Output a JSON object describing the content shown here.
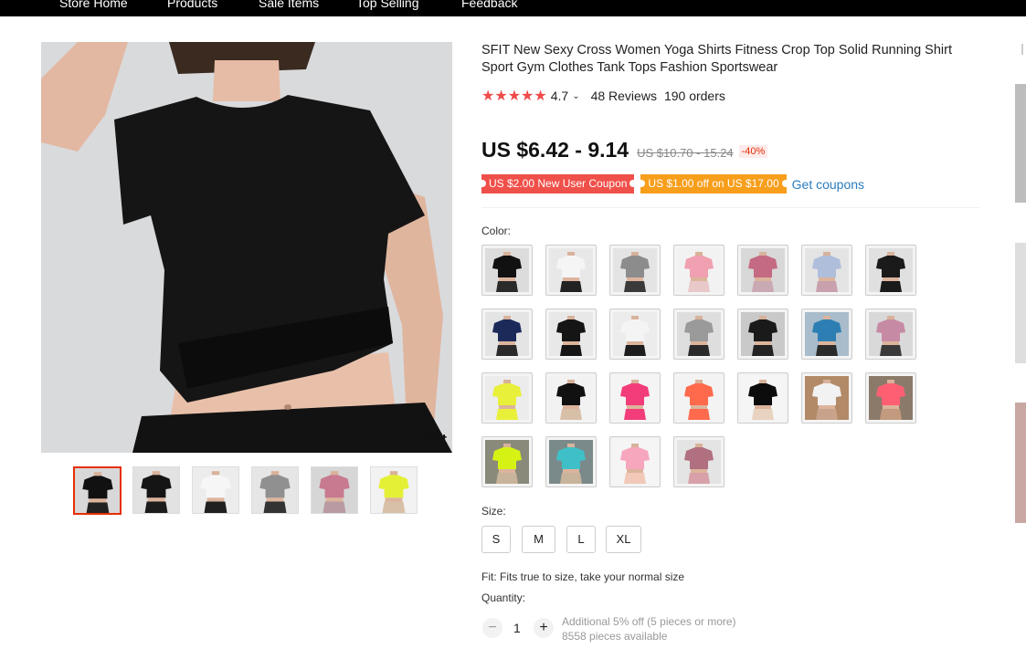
{
  "nav": {
    "items": [
      "Store Home",
      "Products",
      "Sale Items",
      "Top Selling",
      "Feedback"
    ]
  },
  "product": {
    "title": "SFIT New Sexy Cross Women Yoga Shirts Fitness Crop Top Solid Running Shirt Sport Gym Clothes Tank Tops Fashion Sportswear",
    "brand_mark": "Sfit",
    "rating": "4.7",
    "rating_stars": 5,
    "reviews": "48 Reviews",
    "orders": "190 orders",
    "price": "US $6.42 - 9.14",
    "old_price": "US $10.70 - 15.24",
    "discount": "-40%"
  },
  "coupons": {
    "new_user": "US $2.00 New User Coupon",
    "off": "US $1.00 off on US $17.00",
    "get_label": "Get coupons"
  },
  "color": {
    "label": "Color:",
    "swatches": [
      {
        "top": "#111111",
        "bottom": "#2a2a2a",
        "bg": "#dcdcdc"
      },
      {
        "top": "#f5f5f5",
        "bottom": "#222222",
        "bg": "#e8e8e8"
      },
      {
        "top": "#8c8c8c",
        "bottom": "#3a3a3a",
        "bg": "#e4e4e4"
      },
      {
        "top": "#f0a0b0",
        "bottom": "#e8c8c8",
        "bg": "#f2f2f2"
      },
      {
        "top": "#c46a82",
        "bottom": "#c9a9b2",
        "bg": "#d8d8d8"
      },
      {
        "top": "#aebedb",
        "bottom": "#c8a1ad",
        "bg": "#e4e4e4"
      },
      {
        "top": "#1a1a1a",
        "bottom": "#1a1a1a",
        "bg": "#e0e0e0"
      },
      {
        "top": "#1c2a5a",
        "bottom": "#2a2a2a",
        "bg": "#e4e4e4"
      },
      {
        "top": "#151515",
        "bottom": "#151515",
        "bg": "#e8e8e8"
      },
      {
        "top": "#f4f4f4",
        "bottom": "#1d1d1d",
        "bg": "#ececec"
      },
      {
        "top": "#9a9a9a",
        "bottom": "#2a2a2a",
        "bg": "#dedede"
      },
      {
        "top": "#1a1a1a",
        "bottom": "#222222",
        "bg": "#c9c9c9"
      },
      {
        "top": "#2d7fb3",
        "bottom": "#2a2a2a",
        "bg": "#a8bccb"
      },
      {
        "top": "#c78aa4",
        "bottom": "#3a3a3a",
        "bg": "#d9d9d9"
      },
      {
        "top": "#e8f03a",
        "bottom": "#e8f03a",
        "bg": "#ececec"
      },
      {
        "top": "#111111",
        "bottom": "#d8bfa8",
        "bg": "#f2f2f2"
      },
      {
        "top": "#f23d7a",
        "bottom": "#f23d7a",
        "bg": "#f4f4f4"
      },
      {
        "top": "#ff6a4d",
        "bottom": "#ff6a4d",
        "bg": "#f3f3f3"
      },
      {
        "top": "#0c0c0c",
        "bottom": "#e8d2c0",
        "bg": "#f5f5f5"
      },
      {
        "top": "#f2f2f2",
        "bottom": "#c8a28a",
        "bg": "#b38a67"
      },
      {
        "top": "#ff5f73",
        "bottom": "#c29a7e",
        "bg": "#8b7a6a"
      },
      {
        "top": "#d6f215",
        "bottom": "#c8b49a",
        "bg": "#8a8a7a"
      },
      {
        "top": "#3fc0c8",
        "bottom": "#c8b49a",
        "bg": "#7a8a8a"
      },
      {
        "top": "#f6a6bd",
        "bottom": "#f2c8b8",
        "bg": "#f5f5f5"
      },
      {
        "top": "#b07080",
        "bottom": "#d8a0a8",
        "bg": "#e4e4e4"
      }
    ]
  },
  "thumbs": [
    {
      "top": "#111111",
      "bottom": "#222222",
      "bg": "#d8d8d8"
    },
    {
      "top": "#151515",
      "bottom": "#1c1c1c",
      "bg": "#e2e2e2"
    },
    {
      "top": "#f6f6f6",
      "bottom": "#202020",
      "bg": "#ececec"
    },
    {
      "top": "#909090",
      "bottom": "#333333",
      "bg": "#e6e6e6"
    },
    {
      "top": "#c77a90",
      "bottom": "#b99aa2",
      "bg": "#d6d6d6"
    },
    {
      "top": "#e4f036",
      "bottom": "#d8c0a8",
      "bg": "#f2f2f2"
    }
  ],
  "size": {
    "label": "Size:",
    "options": [
      "S",
      "M",
      "L",
      "XL"
    ]
  },
  "fit_text": "Fit: Fits true to size, take your normal size",
  "quantity": {
    "label": "Quantity:",
    "value": "1",
    "minus": "−",
    "plus": "+",
    "note_discount": "Additional 5% off (5 pieces or more)",
    "note_available": "8558 pieces available"
  }
}
